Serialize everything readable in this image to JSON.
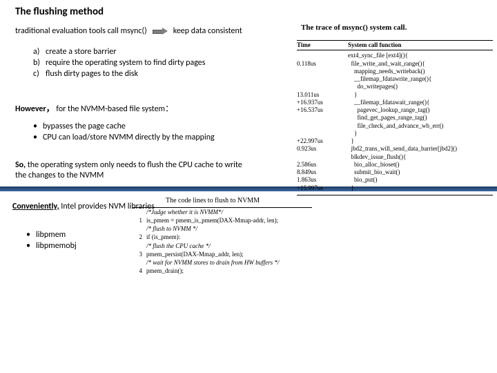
{
  "title": "The flushing method",
  "intro": {
    "left": "traditional evaluation tools call msync()",
    "right": "keep data consistent"
  },
  "list1": {
    "a": "create a store barrier",
    "b": "require the operating system to find dirty pages",
    "c": "flush dirty pages to the disk"
  },
  "however": {
    "label": "However，",
    "rest": " for the NVMM-based file system："
  },
  "list2": {
    "i0": "bypasses the page cache",
    "i1": "CPU can load/store NVMM directly by the mapping"
  },
  "so": {
    "bold": "So, ",
    "rest": "the operating system only needs to flush the CPU cache to write the changes to the NVMM"
  },
  "conv": {
    "bold": "Conveniently,",
    "rest": " Intel provides NVM libraries"
  },
  "list3": {
    "i0": "libpmem",
    "i1": "libpmemobj"
  },
  "trace": {
    "caption": "The trace of msync() system call.",
    "h1": "Time",
    "h2": "System call function",
    "times": [
      "",
      "0.118us",
      "",
      "",
      "",
      "13.011us",
      "+16.937us",
      "+16.537us",
      "",
      "",
      "",
      "+22.997us",
      "0.923us",
      "",
      "2.586us",
      "8.849us",
      "1.863us",
      "+15.997us"
    ],
    "funcs": [
      "ext4_sync_file [ext4](){",
      "  file_write_and_wait_range(){",
      "    mapping_needs_writeback()",
      "    __filemap_fdatawrite_range(){",
      "      do_writepages()",
      "    }",
      "    __filemap_fdatawait_range(){",
      "      pagevec_lookup_range_tag()",
      "      find_get_pages_range_tag()",
      "      file_check_and_advance_wb_err()",
      "    }",
      "  }",
      "  jbd2_trans_will_send_data_barrier[jbd2]()",
      "  blkdev_issue_flush(){",
      "    bio_alloc_bioset()",
      "    submit_bio_wait()",
      "    bio_put()",
      "  }"
    ]
  },
  "code": {
    "caption": "The code lines to flush to NVMM",
    "lines": [
      {
        "n": "",
        "t": "/*Judge whether it is NVMM*/",
        "k": "cmt"
      },
      {
        "n": "1",
        "t": "is_pmem = pmem_is_pmem(DAX-Mmap-addr, len);",
        "k": "fn"
      },
      {
        "n": "",
        "t": "/* flush to NVMM */",
        "k": "cmt"
      },
      {
        "n": "2",
        "t": "if (is_pmem):",
        "k": "fn"
      },
      {
        "n": "",
        "t": "/* flush the CPU cache */",
        "k": "cmt"
      },
      {
        "n": "3",
        "t": "    pmem_persist(DAX-Mmap_addr, len);",
        "k": "fn"
      },
      {
        "n": "",
        "t": "/* wait for NVMM stores to drain from HW buffers */",
        "k": "cmt"
      },
      {
        "n": "4",
        "t": "    pmem_drain();",
        "k": "fn"
      }
    ]
  }
}
